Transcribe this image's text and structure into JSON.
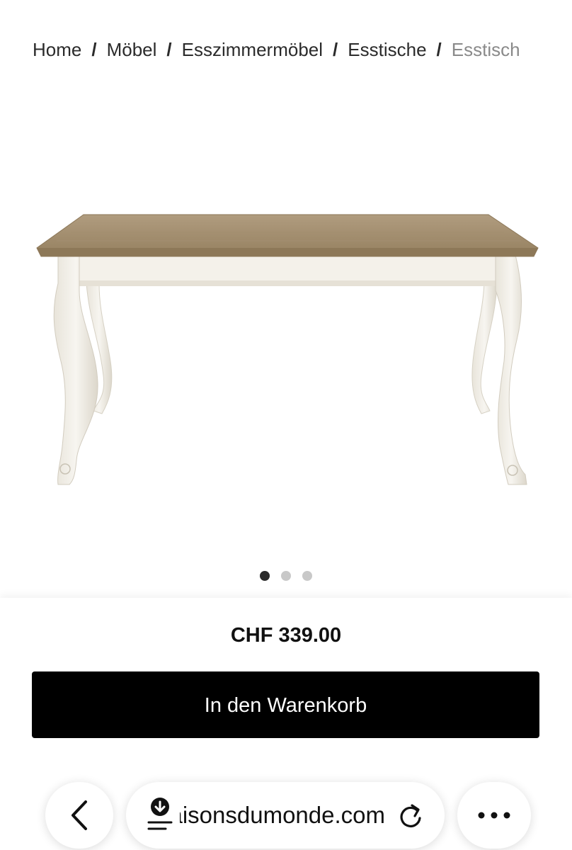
{
  "breadcrumb": {
    "items": [
      "Home",
      "Möbel",
      "Esszimmermöbel",
      "Esstische"
    ],
    "current": "Esstisch",
    "separator": "/"
  },
  "product": {
    "image_alt_icon": "dining-table-image",
    "gallery": {
      "count": 3,
      "active_index": 0
    }
  },
  "buy_panel": {
    "price": "CHF 339.00",
    "cart_button_label": "In den Warenkorb"
  },
  "browser": {
    "url_display": "maisonsdumonde.com",
    "back_icon": "chevron-left-icon",
    "download_icon": "download-icon",
    "reload_icon": "reload-icon",
    "more_icon": "more-icon"
  },
  "colors": {
    "button_bg": "#000000",
    "button_text": "#ffffff",
    "dot_active": "#2a2a2a",
    "dot_inactive": "#c8c8c8",
    "table_top": "#a08b6d",
    "table_body": "#f2efe8"
  }
}
